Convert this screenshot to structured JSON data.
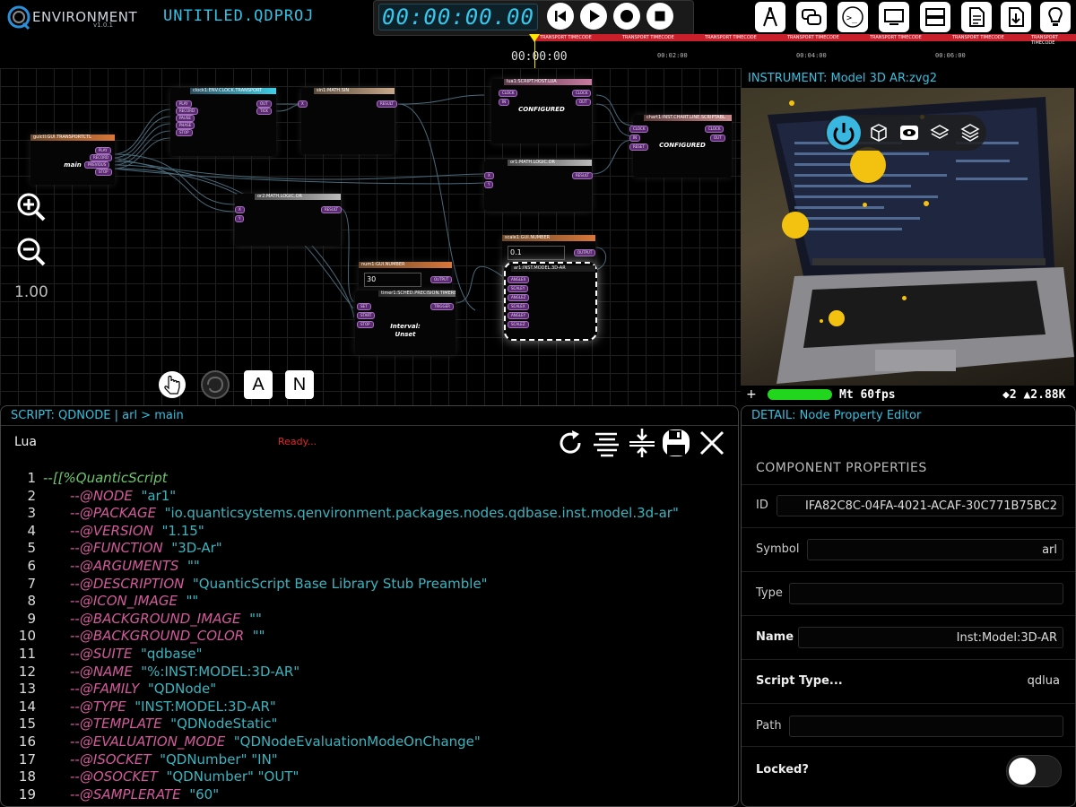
{
  "app": {
    "logo_text": "ENVIRONMENT",
    "logo_version": "v1.0.1",
    "project_title": "UNTITLED.QDPROJ"
  },
  "transport": {
    "timecode": "00:00:00.00",
    "buttons": [
      "skip-back-icon",
      "play-icon",
      "record-icon",
      "stop-icon"
    ]
  },
  "toolbar_icons": [
    "compass-icon",
    "chat-icon",
    "terminal-icon",
    "monitor-icon",
    "server-icon",
    "document-icon",
    "download-icon",
    "lightbulb-icon"
  ],
  "timeline": {
    "transport_label": "TRANSPORT TIMECODE",
    "ruler_main": "00:00:00",
    "ticks": [
      "00:02:00",
      "00:04:00",
      "00:06:00"
    ]
  },
  "canvas": {
    "zoom_level": "1.00",
    "tool_buttons": [
      "A",
      "N"
    ],
    "nodes": [
      {
        "id": "guictl",
        "title": "guictl:GUI.TRANSPORTCTL",
        "label": "main",
        "ports": [
          "PLAY",
          "RECORD",
          "PREVIOUS",
          "STOP"
        ]
      },
      {
        "id": "clock1",
        "title": "clock1:ENV.CLOCK.TRANSPORT",
        "ports_in": [
          "PLAY",
          "RECORD",
          "PAUSE",
          "PHASE",
          "STOP"
        ],
        "ports_out": [
          "OUT",
          "TICK"
        ]
      },
      {
        "id": "sin1",
        "title": "sin1:MATH.SIN",
        "ports_in": [
          "X"
        ],
        "ports_out": [
          "RESULT"
        ]
      },
      {
        "id": "lua1",
        "title": "lua1:SCRIPT.HOST.LUA",
        "label": "CONFIGURED",
        "ports_in": [
          "CLOCK",
          "IN"
        ],
        "ports_out": [
          "CLOCK",
          "OUT"
        ]
      },
      {
        "id": "chart1",
        "title": "chart1:INST.CHART.LINE.SCRIPTABL",
        "label": "CONFIGURED",
        "ports_in": [
          "CLOCK",
          "IN",
          "RESET"
        ],
        "ports_out": [
          "CLOCK",
          "OUT"
        ]
      },
      {
        "id": "or1",
        "title": "or1:MATH.LOGIC.OR",
        "ports_in": [
          "X",
          "Y"
        ],
        "ports_out": [
          "RESULT"
        ]
      },
      {
        "id": "or2",
        "title": "or2:MATH.LOGIC.OR",
        "ports_in": [
          "X",
          "Y"
        ],
        "ports_out": [
          "RESULT"
        ]
      },
      {
        "id": "num1",
        "title": "num1:GUI.NUMBER",
        "value": "30",
        "ports_out": [
          "OUTPUT"
        ]
      },
      {
        "id": "timer1",
        "title": "timer1:SCHED.PRECISION.TIMERBE",
        "label": "Interval:\nUnset",
        "ports_in": [
          "SET",
          "START",
          "STOP"
        ],
        "ports_out": [
          "TRIGGER"
        ]
      },
      {
        "id": "scale1",
        "title": "scale1:GUI.NUMBER",
        "value": "0.1",
        "ports_out": [
          "OUTPUT"
        ]
      },
      {
        "id": "ar1",
        "title": "ar1:INST.MODEL.3D-AR",
        "ports_in": [
          "ANGLEX",
          "SCALEY",
          "ANGLEZ",
          "SCALEX",
          "ANGLEY",
          "SCALEZ"
        ]
      }
    ]
  },
  "instrument": {
    "title": "INSTRUMENT: Model 3D AR:zvg2",
    "status_plus": "+",
    "status_fps": "Mt 60fps",
    "status_right": "◆2 ▲2.88K",
    "bar_fill": 1.0,
    "toolbar_icons": [
      "power-icon",
      "cube-icon",
      "eye-icon",
      "layers-icon",
      "layers-stack-icon"
    ]
  },
  "script": {
    "title": "SCRIPT: QDNODE | arl > main",
    "language": "Lua",
    "status": "Ready...",
    "actions": [
      "refresh-icon",
      "format-icon",
      "split-icon",
      "save-icon",
      "close-icon"
    ],
    "lines": [
      {
        "n": "1",
        "key": "",
        "val": "--[[%QuanticScript"
      },
      {
        "n": "2",
        "key": "--@NODE",
        "val": "\"ar1\""
      },
      {
        "n": "3",
        "key": "--@PACKAGE",
        "val": "\"io.quanticsystems.qenvironment.packages.nodes.qdbase.inst.model.3d-ar\""
      },
      {
        "n": "4",
        "key": "--@VERSION",
        "val": "\"1.15\""
      },
      {
        "n": "5",
        "key": "--@FUNCTION",
        "val": "\"3D-Ar\""
      },
      {
        "n": "6",
        "key": "--@ARGUMENTS",
        "val": "\"\""
      },
      {
        "n": "7",
        "key": "--@DESCRIPTION",
        "val": "\"QuanticScript Base Library Stub Preamble\""
      },
      {
        "n": "8",
        "key": "--@ICON_IMAGE",
        "val": "\"\""
      },
      {
        "n": "9",
        "key": "--@BACKGROUND_IMAGE",
        "val": "\"\""
      },
      {
        "n": "10",
        "key": "--@BACKGROUND_COLOR",
        "val": "\"\""
      },
      {
        "n": "11",
        "key": "--@SUITE",
        "val": "\"qdbase\""
      },
      {
        "n": "12",
        "key": "--@NAME",
        "val": "\"%:INST:MODEL:3D-AR\""
      },
      {
        "n": "13",
        "key": "--@FAMILY",
        "val": "\"QDNode\""
      },
      {
        "n": "14",
        "key": "--@TYPE",
        "val": "\"INST:MODEL:3D-AR\""
      },
      {
        "n": "15",
        "key": "--@TEMPLATE",
        "val": "\"QDNodeStatic\""
      },
      {
        "n": "16",
        "key": "--@EVALUATION_MODE",
        "val": "\"QDNodeEvaluationModeOnChange\""
      },
      {
        "n": "17",
        "key": "--@ISOCKET",
        "val": "\"QDNumber\" \"IN\""
      },
      {
        "n": "18",
        "key": "--@OSOCKET",
        "val": "\"QDNumber\" \"OUT\""
      },
      {
        "n": "19",
        "key": "--@SAMPLERATE",
        "val": "\"60\""
      }
    ]
  },
  "detail": {
    "title": "DETAIL: Node Property Editor",
    "section": "COMPONENT PROPERTIES",
    "id_label": "ID",
    "id_value": "IFA82C8C-04FA-4021-ACAF-30C771B75BC2",
    "symbol_label": "Symbol",
    "symbol_value": "arl",
    "type_label": "Type",
    "type_value": "",
    "name_label": "Name",
    "name_value": "Inst:Model:3D-AR",
    "script_type_label": "Script Type...",
    "script_type_value": "qdlua",
    "path_label": "Path",
    "path_value": "",
    "locked_label": "Locked?",
    "locked": false
  },
  "colors": {
    "accent": "#35c0e0",
    "record_red": "#c81f2a",
    "port_purple": "#5b2a6e",
    "fps_green": "#22d61e",
    "ar_dot": "#f3c10f"
  }
}
